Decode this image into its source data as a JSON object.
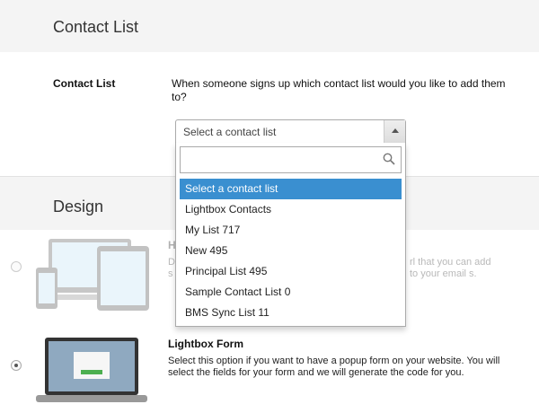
{
  "sections": {
    "contact_list_title": "Contact List",
    "design_title": "Design"
  },
  "contact_list": {
    "label": "Contact List",
    "description": "When someone signs up which contact list would you like to add them to?",
    "selected_value": "Select a contact list",
    "search_value": "",
    "options": [
      "Select a contact list",
      "Lightbox Contacts",
      "My List 717",
      "New 495",
      "Principal List 495",
      "Sample Contact List 0",
      "BMS Sync List 11"
    ],
    "highlighted_index": 0
  },
  "design": {
    "hosted": {
      "title": "H",
      "description_left": "D s",
      "description_right": "rl that you can add to your email s."
    },
    "lightbox": {
      "title": "Lightbox Form",
      "description": "Select this option if you want to have a popup form on your website. You will select the fields for your form and we will generate the code for you."
    }
  },
  "colors": {
    "highlight": "#3a8fd0",
    "header_bg": "#f4f4f4",
    "device_screen": "#bfe3f4"
  }
}
